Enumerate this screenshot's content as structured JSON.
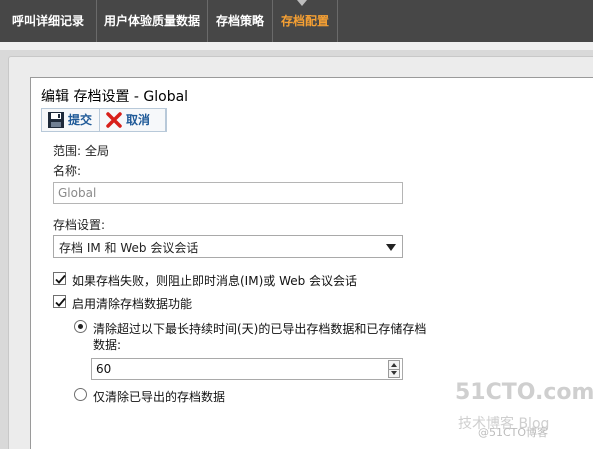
{
  "topnav": {
    "tabs": [
      {
        "label": "呼叫详细记录"
      },
      {
        "label": "用户体验质量数据"
      },
      {
        "label": "存档策略"
      },
      {
        "label": "存档配置"
      }
    ],
    "active_color": "#f6a033"
  },
  "dialog": {
    "title": "编辑 存档设置 - Global",
    "toolbar": {
      "submit_label": "提交",
      "cancel_label": "取消",
      "submit_icon": "save-disk-icon",
      "cancel_icon": "red-x-icon"
    },
    "scope_label": "范围:",
    "scope_value": "全局",
    "name_label": "名称:",
    "name_value": "Global",
    "archive_setting_label": "存档设置:",
    "archive_setting_value": "存档 IM 和 Web 会议会话",
    "block_on_failure_label": "如果存档失败，则阻止即时消息(IM)或 Web 会议会话",
    "block_on_failure_checked": true,
    "enable_purge_label": "启用清除存档数据功能",
    "enable_purge_checked": true,
    "purge_option_1_label_line1": "清除超过以下最长持续时间(天)的已导出存档数据和已存储存档",
    "purge_option_1_label_line2": "数据:",
    "purge_option_1_selected": true,
    "purge_days_value": "60",
    "purge_option_2_label": "仅清除已导出的存档数据",
    "purge_option_2_selected": false
  },
  "watermark": {
    "line1": "51CTO.com",
    "line2": "技术博客  Blog",
    "line3": "@51CTO博客"
  }
}
